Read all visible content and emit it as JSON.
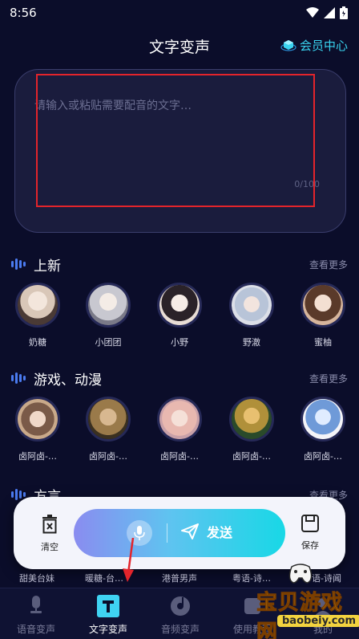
{
  "status_bar": {
    "time": "8:56"
  },
  "header": {
    "title": "文字变声",
    "member_label": "会员中心"
  },
  "input": {
    "placeholder": "请输入或粘贴需要配音的文字…",
    "counter": "0/100"
  },
  "sections": [
    {
      "title": "上新",
      "more": "查看更多",
      "voices": [
        {
          "name": "奶糖",
          "color": "#d9c7b8"
        },
        {
          "name": "小团团",
          "color": "#c8c8d0"
        },
        {
          "name": "小野",
          "color": "#e8ddd5"
        },
        {
          "name": "野澈",
          "color": "#b8c4d8"
        },
        {
          "name": "蜜柚",
          "color": "#d6b59c"
        }
      ]
    },
    {
      "title": "游戏、动漫",
      "more": "查看更多",
      "voices": [
        {
          "name": "卤阿卤-…",
          "color": "#c9a98a"
        },
        {
          "name": "卤阿卤-…",
          "color": "#9a7a4a"
        },
        {
          "name": "卤阿卤-…",
          "color": "#e8b8b0"
        },
        {
          "name": "卤阿卤-…",
          "color": "#4a7a3a"
        },
        {
          "name": "卤阿卤-…",
          "color": "#6f9ad8"
        }
      ]
    },
    {
      "title": "方言",
      "more": "查看更多"
    }
  ],
  "under_labels": [
    "甜美台妹",
    "暖糖-台…",
    "港普男声",
    "粤语-诗…",
    "粤语-诗闻"
  ],
  "actions": {
    "clear": "清空",
    "send": "发送",
    "save": "保存"
  },
  "nav": [
    {
      "label": "语音变声",
      "icon": "microphone-icon"
    },
    {
      "label": "文字变声",
      "icon": "text-t-icon",
      "active": true
    },
    {
      "label": "音频变声",
      "icon": "audio-disc-icon"
    },
    {
      "label": "使用教程",
      "icon": "tutorial-icon"
    },
    {
      "label": "我的",
      "icon": "profile-icon"
    }
  ],
  "watermark": {
    "title": "宝贝游戏网",
    "url": "baobeiy.com"
  },
  "colors": {
    "background": "#0b0d2a",
    "accent": "#39d4f0",
    "highlight": "#e3242b"
  }
}
